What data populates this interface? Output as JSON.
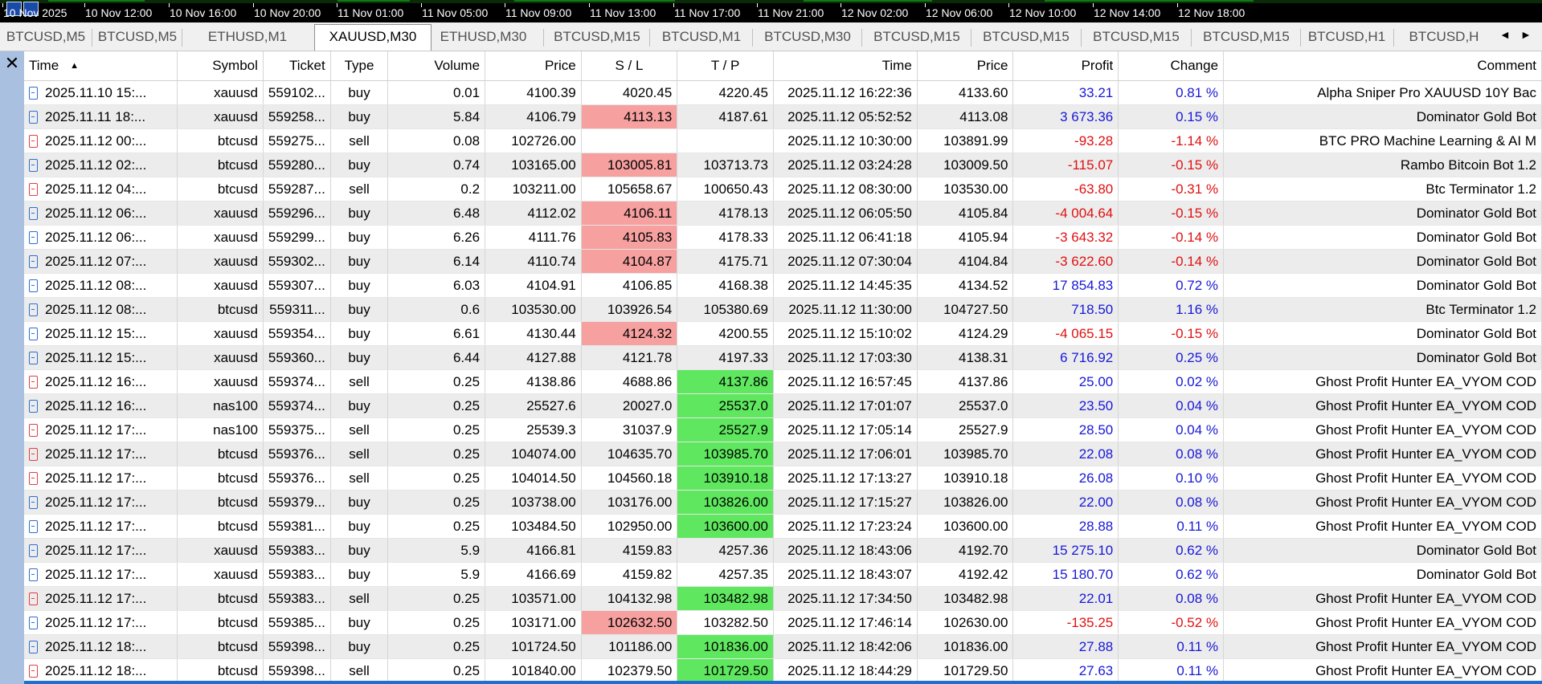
{
  "time_axis": {
    "labels": [
      "10 Nov 2025",
      "10 Nov 12:00",
      "10 Nov 16:00",
      "10 Nov 20:00",
      "11 Nov 01:00",
      "11 Nov 05:00",
      "11 Nov 09:00",
      "11 Nov 13:00",
      "11 Nov 17:00",
      "11 Nov 21:00",
      "12 Nov 02:00",
      "12 Nov 06:00",
      "12 Nov 10:00",
      "12 Nov 14:00",
      "12 Nov 18:00"
    ]
  },
  "tabs": [
    "BTCUSD,M5",
    "BTCUSD,M5",
    "ETHUSD,M1",
    "XAUUSD,M30",
    "ETHUSD,M30",
    "BTCUSD,M15",
    "BTCUSD,M1",
    "BTCUSD,M30",
    "BTCUSD,M15",
    "BTCUSD,M15",
    "BTCUSD,M15",
    "BTCUSD,M15",
    "BTCUSD,H1",
    "BTCUSD,H"
  ],
  "active_tab": 3,
  "nav": {
    "left": "◄",
    "right": "►"
  },
  "close_glyph": "✕",
  "columns": [
    "Time",
    "Symbol",
    "Ticket",
    "Type",
    "Volume",
    "Price",
    "S / L",
    "T / P",
    "Time",
    "Price",
    "Profit",
    "Change",
    "Comment"
  ],
  "sort_glyph": "▲",
  "colors": {
    "profit_blue": "#1818d8",
    "loss_red": "#e01010",
    "sl_hit": "#f7a0a0",
    "tp_hit": "#5fe85f"
  },
  "rows": [
    {
      "open_time": "2025.11.10 15:...",
      "symbol": "xauusd",
      "ticket": "559102...",
      "type": "buy",
      "volume": "0.01",
      "price": "4100.39",
      "sl": "4020.45",
      "tp": "4220.45",
      "close_time": "2025.11.12 16:22:36",
      "close_price": "4133.60",
      "profit": "33.21",
      "change": "0.81 %",
      "comment": "Alpha Sniper Pro XAUUSD 10Y Bac",
      "hl": ""
    },
    {
      "open_time": "2025.11.11 18:...",
      "symbol": "xauusd",
      "ticket": "559258...",
      "type": "buy",
      "volume": "5.84",
      "price": "4106.79",
      "sl": "4113.13",
      "tp": "4187.61",
      "close_time": "2025.11.12 05:52:52",
      "close_price": "4113.08",
      "profit": "3 673.36",
      "change": "0.15 %",
      "comment": "Dominator Gold Bot",
      "hl": "sl"
    },
    {
      "open_time": "2025.11.12 00:...",
      "symbol": "btcusd",
      "ticket": "559275...",
      "type": "sell",
      "volume": "0.08",
      "price": "102726.00",
      "sl": "",
      "tp": "",
      "close_time": "2025.11.12 10:30:00",
      "close_price": "103891.99",
      "profit": "-93.28",
      "change": "-1.14 %",
      "comment": "BTC PRO Machine Learning & AI M",
      "hl": ""
    },
    {
      "open_time": "2025.11.12 02:...",
      "symbol": "btcusd",
      "ticket": "559280...",
      "type": "buy",
      "volume": "0.74",
      "price": "103165.00",
      "sl": "103005.81",
      "tp": "103713.73",
      "close_time": "2025.11.12 03:24:28",
      "close_price": "103009.50",
      "profit": "-115.07",
      "change": "-0.15 %",
      "comment": "Rambo Bitcoin Bot 1.2",
      "hl": "sl"
    },
    {
      "open_time": "2025.11.12 04:...",
      "symbol": "btcusd",
      "ticket": "559287...",
      "type": "sell",
      "volume": "0.2",
      "price": "103211.00",
      "sl": "105658.67",
      "tp": "100650.43",
      "close_time": "2025.11.12 08:30:00",
      "close_price": "103530.00",
      "profit": "-63.80",
      "change": "-0.31 %",
      "comment": "Btc Terminator 1.2",
      "hl": ""
    },
    {
      "open_time": "2025.11.12 06:...",
      "symbol": "xauusd",
      "ticket": "559296...",
      "type": "buy",
      "volume": "6.48",
      "price": "4112.02",
      "sl": "4106.11",
      "tp": "4178.13",
      "close_time": "2025.11.12 06:05:50",
      "close_price": "4105.84",
      "profit": "-4 004.64",
      "change": "-0.15 %",
      "comment": "Dominator Gold Bot",
      "hl": "sl"
    },
    {
      "open_time": "2025.11.12 06:...",
      "symbol": "xauusd",
      "ticket": "559299...",
      "type": "buy",
      "volume": "6.26",
      "price": "4111.76",
      "sl": "4105.83",
      "tp": "4178.33",
      "close_time": "2025.11.12 06:41:18",
      "close_price": "4105.94",
      "profit": "-3 643.32",
      "change": "-0.14 %",
      "comment": "Dominator Gold Bot",
      "hl": "sl"
    },
    {
      "open_time": "2025.11.12 07:...",
      "symbol": "xauusd",
      "ticket": "559302...",
      "type": "buy",
      "volume": "6.14",
      "price": "4110.74",
      "sl": "4104.87",
      "tp": "4175.71",
      "close_time": "2025.11.12 07:30:04",
      "close_price": "4104.84",
      "profit": "-3 622.60",
      "change": "-0.14 %",
      "comment": "Dominator Gold Bot",
      "hl": "sl"
    },
    {
      "open_time": "2025.11.12 08:...",
      "symbol": "xauusd",
      "ticket": "559307...",
      "type": "buy",
      "volume": "6.03",
      "price": "4104.91",
      "sl": "4106.85",
      "tp": "4168.38",
      "close_time": "2025.11.12 14:45:35",
      "close_price": "4134.52",
      "profit": "17 854.83",
      "change": "0.72 %",
      "comment": "Dominator Gold Bot",
      "hl": ""
    },
    {
      "open_time": "2025.11.12 08:...",
      "symbol": "btcusd",
      "ticket": "559311...",
      "type": "buy",
      "volume": "0.6",
      "price": "103530.00",
      "sl": "103926.54",
      "tp": "105380.69",
      "close_time": "2025.11.12 11:30:00",
      "close_price": "104727.50",
      "profit": "718.50",
      "change": "1.16 %",
      "comment": "Btc Terminator 1.2",
      "hl": ""
    },
    {
      "open_time": "2025.11.12 15:...",
      "symbol": "xauusd",
      "ticket": "559354...",
      "type": "buy",
      "volume": "6.61",
      "price": "4130.44",
      "sl": "4124.32",
      "tp": "4200.55",
      "close_time": "2025.11.12 15:10:02",
      "close_price": "4124.29",
      "profit": "-4 065.15",
      "change": "-0.15 %",
      "comment": "Dominator Gold Bot",
      "hl": "sl"
    },
    {
      "open_time": "2025.11.12 15:...",
      "symbol": "xauusd",
      "ticket": "559360...",
      "type": "buy",
      "volume": "6.44",
      "price": "4127.88",
      "sl": "4121.78",
      "tp": "4197.33",
      "close_time": "2025.11.12 17:03:30",
      "close_price": "4138.31",
      "profit": "6 716.92",
      "change": "0.25 %",
      "comment": "Dominator Gold Bot",
      "hl": ""
    },
    {
      "open_time": "2025.11.12 16:...",
      "symbol": "xauusd",
      "ticket": "559374...",
      "type": "sell",
      "volume": "0.25",
      "price": "4138.86",
      "sl": "4688.86",
      "tp": "4137.86",
      "close_time": "2025.11.12 16:57:45",
      "close_price": "4137.86",
      "profit": "25.00",
      "change": "0.02 %",
      "comment": "Ghost Profit Hunter EA_VYOM COD",
      "hl": "tp"
    },
    {
      "open_time": "2025.11.12 16:...",
      "symbol": "nas100",
      "ticket": "559374...",
      "type": "buy",
      "volume": "0.25",
      "price": "25527.6",
      "sl": "20027.0",
      "tp": "25537.0",
      "close_time": "2025.11.12 17:01:07",
      "close_price": "25537.0",
      "profit": "23.50",
      "change": "0.04 %",
      "comment": "Ghost Profit Hunter EA_VYOM COD",
      "hl": "tp"
    },
    {
      "open_time": "2025.11.12 17:...",
      "symbol": "nas100",
      "ticket": "559375...",
      "type": "sell",
      "volume": "0.25",
      "price": "25539.3",
      "sl": "31037.9",
      "tp": "25527.9",
      "close_time": "2025.11.12 17:05:14",
      "close_price": "25527.9",
      "profit": "28.50",
      "change": "0.04 %",
      "comment": "Ghost Profit Hunter EA_VYOM COD",
      "hl": "tp"
    },
    {
      "open_time": "2025.11.12 17:...",
      "symbol": "btcusd",
      "ticket": "559376...",
      "type": "sell",
      "volume": "0.25",
      "price": "104074.00",
      "sl": "104635.70",
      "tp": "103985.70",
      "close_time": "2025.11.12 17:06:01",
      "close_price": "103985.70",
      "profit": "22.08",
      "change": "0.08 %",
      "comment": "Ghost Profit Hunter EA_VYOM COD",
      "hl": "tp"
    },
    {
      "open_time": "2025.11.12 17:...",
      "symbol": "btcusd",
      "ticket": "559376...",
      "type": "sell",
      "volume": "0.25",
      "price": "104014.50",
      "sl": "104560.18",
      "tp": "103910.18",
      "close_time": "2025.11.12 17:13:27",
      "close_price": "103910.18",
      "profit": "26.08",
      "change": "0.10 %",
      "comment": "Ghost Profit Hunter EA_VYOM COD",
      "hl": "tp"
    },
    {
      "open_time": "2025.11.12 17:...",
      "symbol": "btcusd",
      "ticket": "559379...",
      "type": "buy",
      "volume": "0.25",
      "price": "103738.00",
      "sl": "103176.00",
      "tp": "103826.00",
      "close_time": "2025.11.12 17:15:27",
      "close_price": "103826.00",
      "profit": "22.00",
      "change": "0.08 %",
      "comment": "Ghost Profit Hunter EA_VYOM COD",
      "hl": "tp"
    },
    {
      "open_time": "2025.11.12 17:...",
      "symbol": "btcusd",
      "ticket": "559381...",
      "type": "buy",
      "volume": "0.25",
      "price": "103484.50",
      "sl": "102950.00",
      "tp": "103600.00",
      "close_time": "2025.11.12 17:23:24",
      "close_price": "103600.00",
      "profit": "28.88",
      "change": "0.11 %",
      "comment": "Ghost Profit Hunter EA_VYOM COD",
      "hl": "tp"
    },
    {
      "open_time": "2025.11.12 17:...",
      "symbol": "xauusd",
      "ticket": "559383...",
      "type": "buy",
      "volume": "5.9",
      "price": "4166.81",
      "sl": "4159.83",
      "tp": "4257.36",
      "close_time": "2025.11.12 18:43:06",
      "close_price": "4192.70",
      "profit": "15 275.10",
      "change": "0.62 %",
      "comment": "Dominator Gold Bot",
      "hl": ""
    },
    {
      "open_time": "2025.11.12 17:...",
      "symbol": "xauusd",
      "ticket": "559383...",
      "type": "buy",
      "volume": "5.9",
      "price": "4166.69",
      "sl": "4159.82",
      "tp": "4257.35",
      "close_time": "2025.11.12 18:43:07",
      "close_price": "4192.42",
      "profit": "15 180.70",
      "change": "0.62 %",
      "comment": "Dominator Gold Bot",
      "hl": ""
    },
    {
      "open_time": "2025.11.12 17:...",
      "symbol": "btcusd",
      "ticket": "559383...",
      "type": "sell",
      "volume": "0.25",
      "price": "103571.00",
      "sl": "104132.98",
      "tp": "103482.98",
      "close_time": "2025.11.12 17:34:50",
      "close_price": "103482.98",
      "profit": "22.01",
      "change": "0.08 %",
      "comment": "Ghost Profit Hunter EA_VYOM COD",
      "hl": "tp"
    },
    {
      "open_time": "2025.11.12 17:...",
      "symbol": "btcusd",
      "ticket": "559385...",
      "type": "buy",
      "volume": "0.25",
      "price": "103171.00",
      "sl": "102632.50",
      "tp": "103282.50",
      "close_time": "2025.11.12 17:46:14",
      "close_price": "102630.00",
      "profit": "-135.25",
      "change": "-0.52 %",
      "comment": "Ghost Profit Hunter EA_VYOM COD",
      "hl": "sl"
    },
    {
      "open_time": "2025.11.12 18:...",
      "symbol": "btcusd",
      "ticket": "559398...",
      "type": "buy",
      "volume": "0.25",
      "price": "101724.50",
      "sl": "101186.00",
      "tp": "101836.00",
      "close_time": "2025.11.12 18:42:06",
      "close_price": "101836.00",
      "profit": "27.88",
      "change": "0.11 %",
      "comment": "Ghost Profit Hunter EA_VYOM COD",
      "hl": "tp"
    },
    {
      "open_time": "2025.11.12 18:...",
      "symbol": "btcusd",
      "ticket": "559398...",
      "type": "sell",
      "volume": "0.25",
      "price": "101840.00",
      "sl": "102379.50",
      "tp": "101729.50",
      "close_time": "2025.11.12 18:44:29",
      "close_price": "101729.50",
      "profit": "27.63",
      "change": "0.11 %",
      "comment": "Ghost Profit Hunter EA_VYOM COD",
      "hl": "tp"
    }
  ]
}
